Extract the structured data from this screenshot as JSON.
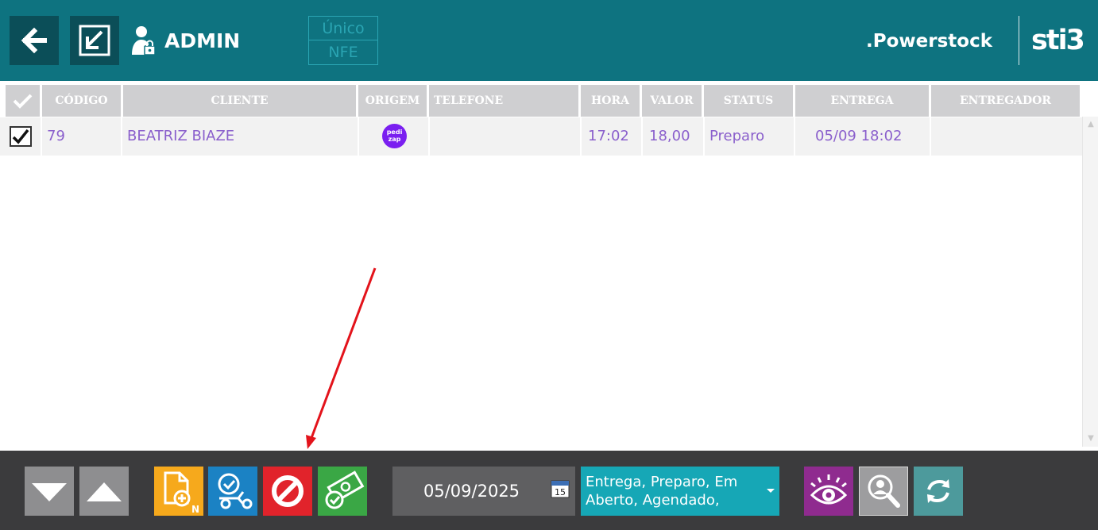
{
  "header": {
    "user": "ADMIN",
    "mode_options": [
      "Único",
      "NFE"
    ],
    "brand": ".Powerstock",
    "logo": "sti3",
    "bg_color": "#0e7380"
  },
  "grid": {
    "columns": [
      "CÓDIGO",
      "CLIENTE",
      "ORIGEM",
      "TELEFONE",
      "HORA",
      "VALOR",
      "STATUS",
      "ENTREGA",
      "ENTREGADOR"
    ],
    "rows": [
      {
        "selected": true,
        "codigo": "79",
        "cliente": "BEATRIZ BIAZE",
        "origem_logo": "pedi zap",
        "telefone": "",
        "hora": "17:02",
        "valor": "18,00",
        "status": "Preparo",
        "entrega": "05/09 18:02",
        "entregador": ""
      }
    ],
    "row_text_color": "#8a5fcc"
  },
  "footer": {
    "date": "05/09/2025",
    "calendar_day": "15",
    "status_filter": "Entrega, Preparo, Em Aberto, Agendado,",
    "buttons": [
      {
        "name": "down-arrow-button",
        "color": "#8e8e90"
      },
      {
        "name": "up-arrow-button",
        "color": "#8e8e90"
      },
      {
        "name": "new-order-button",
        "color": "#f6a91c",
        "badge": "N"
      },
      {
        "name": "delivery-button",
        "color": "#1b82c4"
      },
      {
        "name": "cancel-order-button",
        "color": "#e1232b"
      },
      {
        "name": "payment-button",
        "color": "#3aa745"
      },
      {
        "name": "view-button",
        "color": "#8f2b8f"
      },
      {
        "name": "search-client-button",
        "color": "#9d9d9f"
      },
      {
        "name": "refresh-button",
        "color": "#4d9a9c"
      }
    ]
  },
  "annotation": {
    "arrow_color": "#e3131b"
  }
}
